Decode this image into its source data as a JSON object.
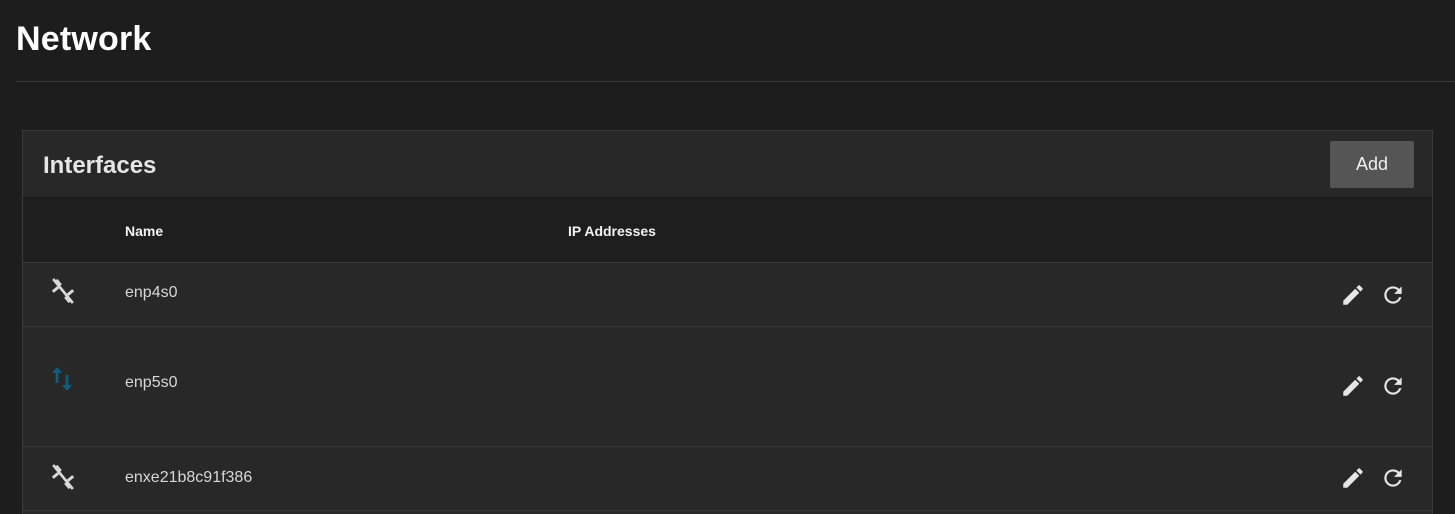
{
  "page": {
    "title": "Network"
  },
  "interfaces_card": {
    "title": "Interfaces",
    "add_label": "Add",
    "columns": {
      "name": "Name",
      "ip_addresses": "IP Addresses"
    },
    "rows": [
      {
        "name": "enp4s0",
        "ip_addresses": "",
        "status_icon": "link-off-icon",
        "status_color": "#d9d9d9"
      },
      {
        "name": "enp5s0",
        "ip_addresses": "",
        "status_icon": "swap-vertical-icon",
        "status_color": "#0f5d80"
      },
      {
        "name": "enxe21b8c91f386",
        "ip_addresses": "",
        "status_icon": "link-off-icon",
        "status_color": "#d9d9d9"
      }
    ],
    "row_actions": {
      "edit_icon": "pencil-icon",
      "reset_icon": "refresh-icon",
      "icon_color": "#e6e6e6"
    }
  },
  "colors": {
    "background": "#1d1d1d",
    "card": "#282828",
    "table_header": "#1e1e1e",
    "button": "#555555",
    "accent": "#0f5d80"
  }
}
